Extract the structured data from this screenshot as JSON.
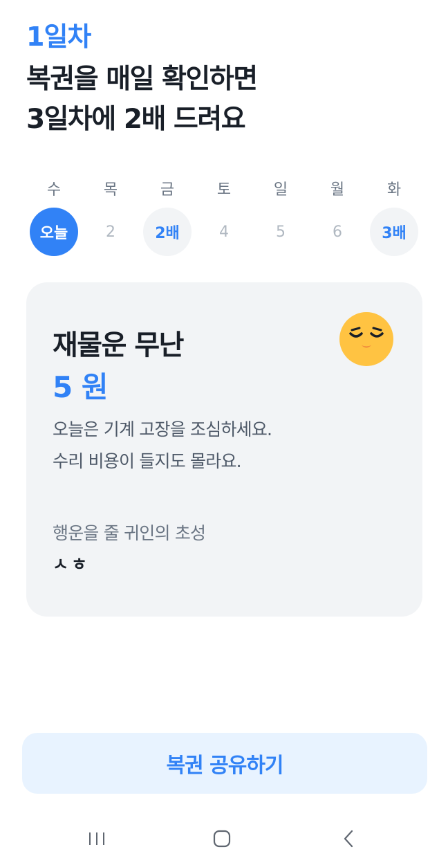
{
  "header": {
    "day_label": "1일차",
    "headline_line1": "복권을 매일 확인하면",
    "headline_line2": "3일차에 2배 드려요"
  },
  "week": {
    "days": [
      {
        "dow": "수",
        "value": "오늘",
        "state": "today"
      },
      {
        "dow": "목",
        "value": "2",
        "state": "future"
      },
      {
        "dow": "금",
        "value": "2배",
        "state": "bonus"
      },
      {
        "dow": "토",
        "value": "4",
        "state": "future"
      },
      {
        "dow": "일",
        "value": "5",
        "state": "future"
      },
      {
        "dow": "월",
        "value": "6",
        "state": "future"
      },
      {
        "dow": "화",
        "value": "3배",
        "state": "bonus"
      }
    ]
  },
  "card": {
    "title": "재물운 무난",
    "amount": "5 원",
    "face_icon": "sleepy-face-icon",
    "desc_line1": "오늘은 기계 고장을 조심하세요.",
    "desc_line2": "수리 비용이 들지도 몰라요.",
    "noble_label": "행운을 줄 귀인의 초성",
    "noble_initials": "ㅅㅎ"
  },
  "actions": {
    "share_label": "복권 공유하기"
  },
  "nav": {
    "recents_icon": "recents-icon",
    "home_icon": "home-icon",
    "back_icon": "back-icon"
  },
  "colors": {
    "accent": "#3182f6",
    "card_bg": "#f2f4f6",
    "button_bg": "#e8f3ff",
    "face": "#ffc342"
  }
}
